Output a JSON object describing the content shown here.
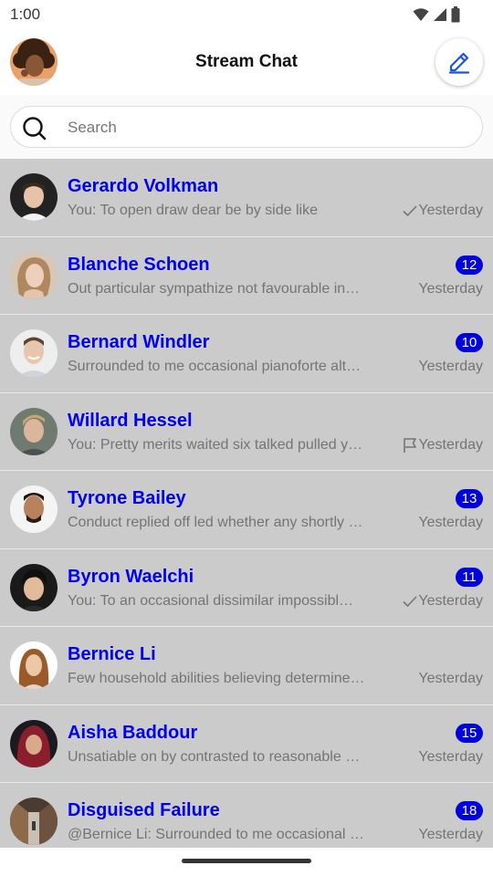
{
  "status_bar": {
    "time": "1:00",
    "icons": [
      "wifi-icon",
      "cellular-signal-icon",
      "battery-icon"
    ]
  },
  "header": {
    "title": "Stream Chat",
    "avatar_icon": "user-avatar",
    "compose_icon": "pencil-icon"
  },
  "search": {
    "placeholder": "Search",
    "value": ""
  },
  "colors": {
    "name": "#0000ee",
    "badge": "#0000dd",
    "accent": "#1a55e0",
    "row_bg": "#cbcbcb"
  },
  "channels": [
    {
      "name": "Gerardo Volkman",
      "preview": "You: To open draw dear be by side like",
      "time": "Yesterday",
      "status_icon": "check-icon",
      "unread": ""
    },
    {
      "name": "Blanche Schoen",
      "preview": "Out particular sympathize not favourable in…",
      "time": "Yesterday",
      "status_icon": "",
      "unread": "12"
    },
    {
      "name": "Bernard Windler",
      "preview": "Surrounded to me occasional pianoforte alt…",
      "time": "Yesterday",
      "status_icon": "",
      "unread": "10"
    },
    {
      "name": "Willard Hessel",
      "preview": "You: Pretty merits waited six talked pulled y…",
      "time": "Yesterday",
      "status_icon": "flag-icon",
      "unread": ""
    },
    {
      "name": "Tyrone Bailey",
      "preview": "Conduct replied off led whether any shortly …",
      "time": "Yesterday",
      "status_icon": "",
      "unread": "13"
    },
    {
      "name": "Byron Waelchi",
      "preview": "You: To an occasional dissimilar impossibl…",
      "time": "Yesterday",
      "status_icon": "check-icon",
      "unread": "11"
    },
    {
      "name": "Bernice Li",
      "preview": "Few household abilities believing determine…",
      "time": "Yesterday",
      "status_icon": "",
      "unread": ""
    },
    {
      "name": "Aisha Baddour",
      "preview": "Unsatiable on by contrasted to reasonable …",
      "time": "Yesterday",
      "status_icon": "",
      "unread": "15"
    },
    {
      "name": "Disguised Failure",
      "preview": "@Bernice Li: Surrounded to me occasional …",
      "time": "Yesterday",
      "status_icon": "",
      "unread": "18"
    }
  ]
}
